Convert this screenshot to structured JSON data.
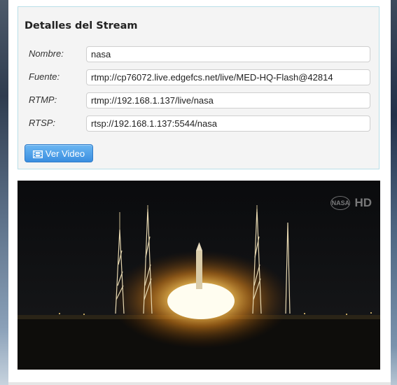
{
  "panel": {
    "title": "Detalles del Stream",
    "fields": [
      {
        "label": "Nombre:",
        "value": "nasa"
      },
      {
        "label": "Fuente:",
        "value": "rtmp://cp76072.live.edgefcs.net/live/MED-HQ-Flash@42814"
      },
      {
        "label": "RTMP:",
        "value": "rtmp://192.168.1.137/live/nasa"
      },
      {
        "label": "RTSP:",
        "value": "rtsp://192.168.1.137:5544/nasa"
      }
    ],
    "button_label": "Ver Video"
  },
  "video": {
    "watermark": "NASA HD",
    "watermark_logo": "NASA",
    "watermark_suffix": "HD"
  },
  "colors": {
    "accent": "#3a8ee0",
    "panel_border": "#b9dfe8",
    "panel_bg": "#f4f4f4"
  }
}
